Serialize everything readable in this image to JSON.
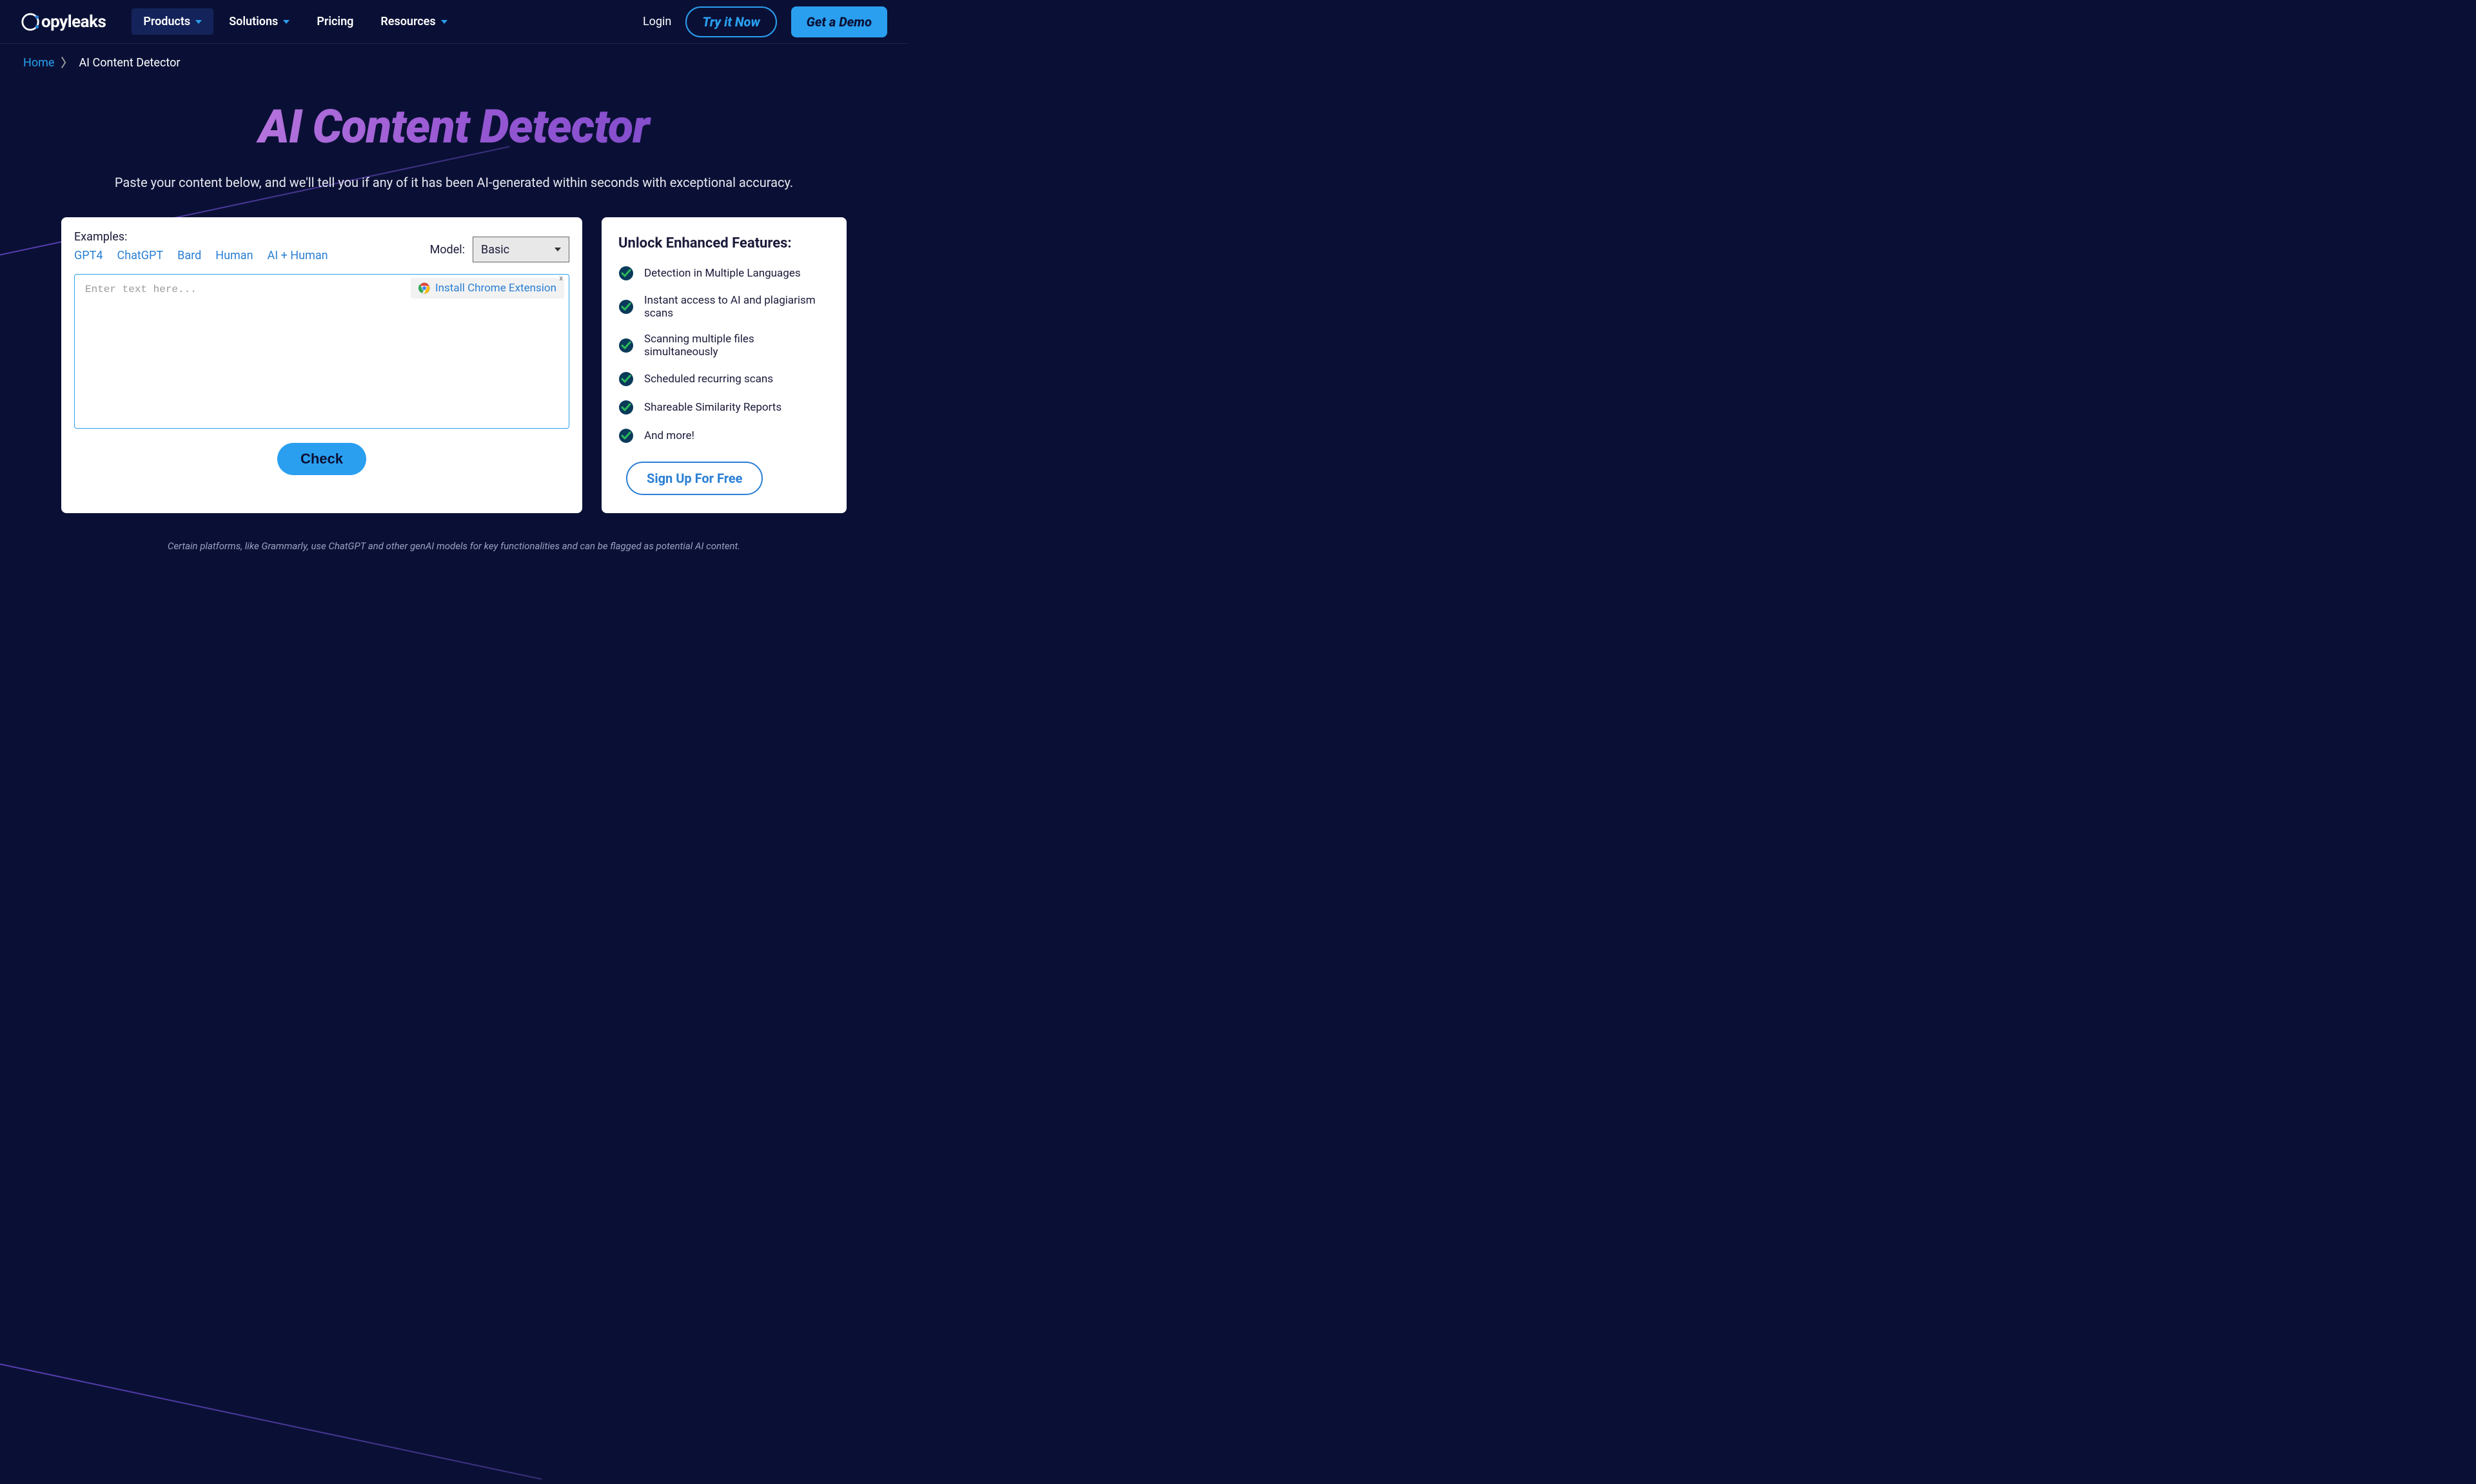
{
  "logo": "opyleaks",
  "nav": {
    "items": [
      {
        "label": "Products",
        "dropdown": true,
        "active": true
      },
      {
        "label": "Solutions",
        "dropdown": true,
        "active": false
      },
      {
        "label": "Pricing",
        "dropdown": false,
        "active": false
      },
      {
        "label": "Resources",
        "dropdown": true,
        "active": false
      }
    ],
    "login": "Login",
    "try": "Try it Now",
    "demo": "Get a Demo"
  },
  "breadcrumb": {
    "home": "Home",
    "current": "AI Content Detector"
  },
  "hero": {
    "title": "AI Content Detector",
    "sub": "Paste your content below, and we'll tell you if any of it has been AI-generated within seconds with exceptional accuracy."
  },
  "detector": {
    "examples_label": "Examples:",
    "examples": [
      "GPT4",
      "ChatGPT",
      "Bard",
      "Human",
      "AI + Human"
    ],
    "model_label": "Model:",
    "model_value": "Basic",
    "placeholder": "Enter text here...",
    "chrome_ext": "Install Chrome Extension",
    "chrome_close": "x",
    "check": "Check"
  },
  "features": {
    "title": "Unlock Enhanced Features:",
    "items": [
      "Detection in Multiple Languages",
      "Instant access to AI and plagiarism scans",
      "Scanning multiple files simultaneously",
      "Scheduled recurring scans",
      "Shareable Similarity Reports",
      "And more!"
    ],
    "signup": "Sign Up For Free"
  },
  "disclaimer": "Certain platforms, like Grammarly, use ChatGPT and other genAI models for key functionalities and can be flagged as potential AI content."
}
